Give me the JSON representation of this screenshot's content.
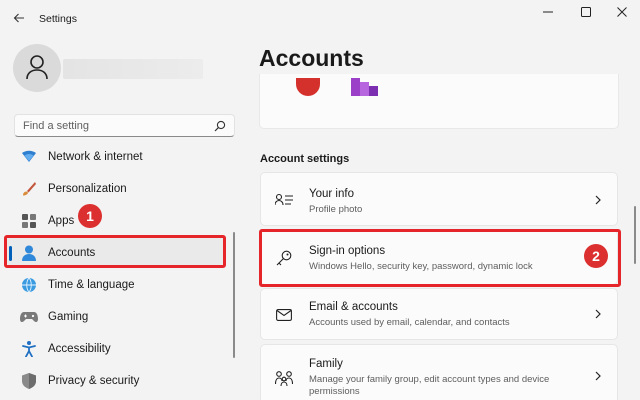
{
  "window": {
    "title": "Settings",
    "back_icon": "back-arrow-icon",
    "minimize_icon": "minimize-icon",
    "maximize_icon": "maximize-icon",
    "close_icon": "close-icon"
  },
  "user": {
    "avatar_icon": "user-avatar-icon"
  },
  "search": {
    "placeholder": "Find a setting",
    "value": "",
    "icon": "search-icon"
  },
  "sidebar": {
    "items": [
      {
        "label": "Network & internet",
        "icon": "wifi-icon",
        "selected": false
      },
      {
        "label": "Personalization",
        "icon": "paintbrush-icon",
        "selected": false
      },
      {
        "label": "Apps",
        "icon": "apps-grid-icon",
        "selected": false
      },
      {
        "label": "Accounts",
        "icon": "person-icon",
        "selected": true
      },
      {
        "label": "Time & language",
        "icon": "globe-clock-icon",
        "selected": false
      },
      {
        "label": "Gaming",
        "icon": "gamepad-icon",
        "selected": false
      },
      {
        "label": "Accessibility",
        "icon": "accessibility-icon",
        "selected": false
      },
      {
        "label": "Privacy & security",
        "icon": "shield-icon",
        "selected": false
      }
    ]
  },
  "annotations": {
    "badge1": "1",
    "badge2": "2",
    "highlight_color": "#e5252a"
  },
  "main": {
    "page_title": "Accounts",
    "section_label": "Account settings",
    "cards": [
      {
        "title": "Your info",
        "subtitle": "Profile photo",
        "icon": "person-card-icon"
      },
      {
        "title": "Sign-in options",
        "subtitle": "Windows Hello, security key, password, dynamic lock",
        "icon": "key-icon"
      },
      {
        "title": "Email & accounts",
        "subtitle": "Accounts used by email, calendar, and contacts",
        "icon": "mail-icon"
      },
      {
        "title": "Family",
        "subtitle": "Manage your family group, edit account types and device permissions",
        "icon": "family-icon"
      }
    ]
  },
  "colors": {
    "accent": "#005fb8",
    "annotation_red": "#e5252a",
    "background": "#f3f3f3"
  }
}
